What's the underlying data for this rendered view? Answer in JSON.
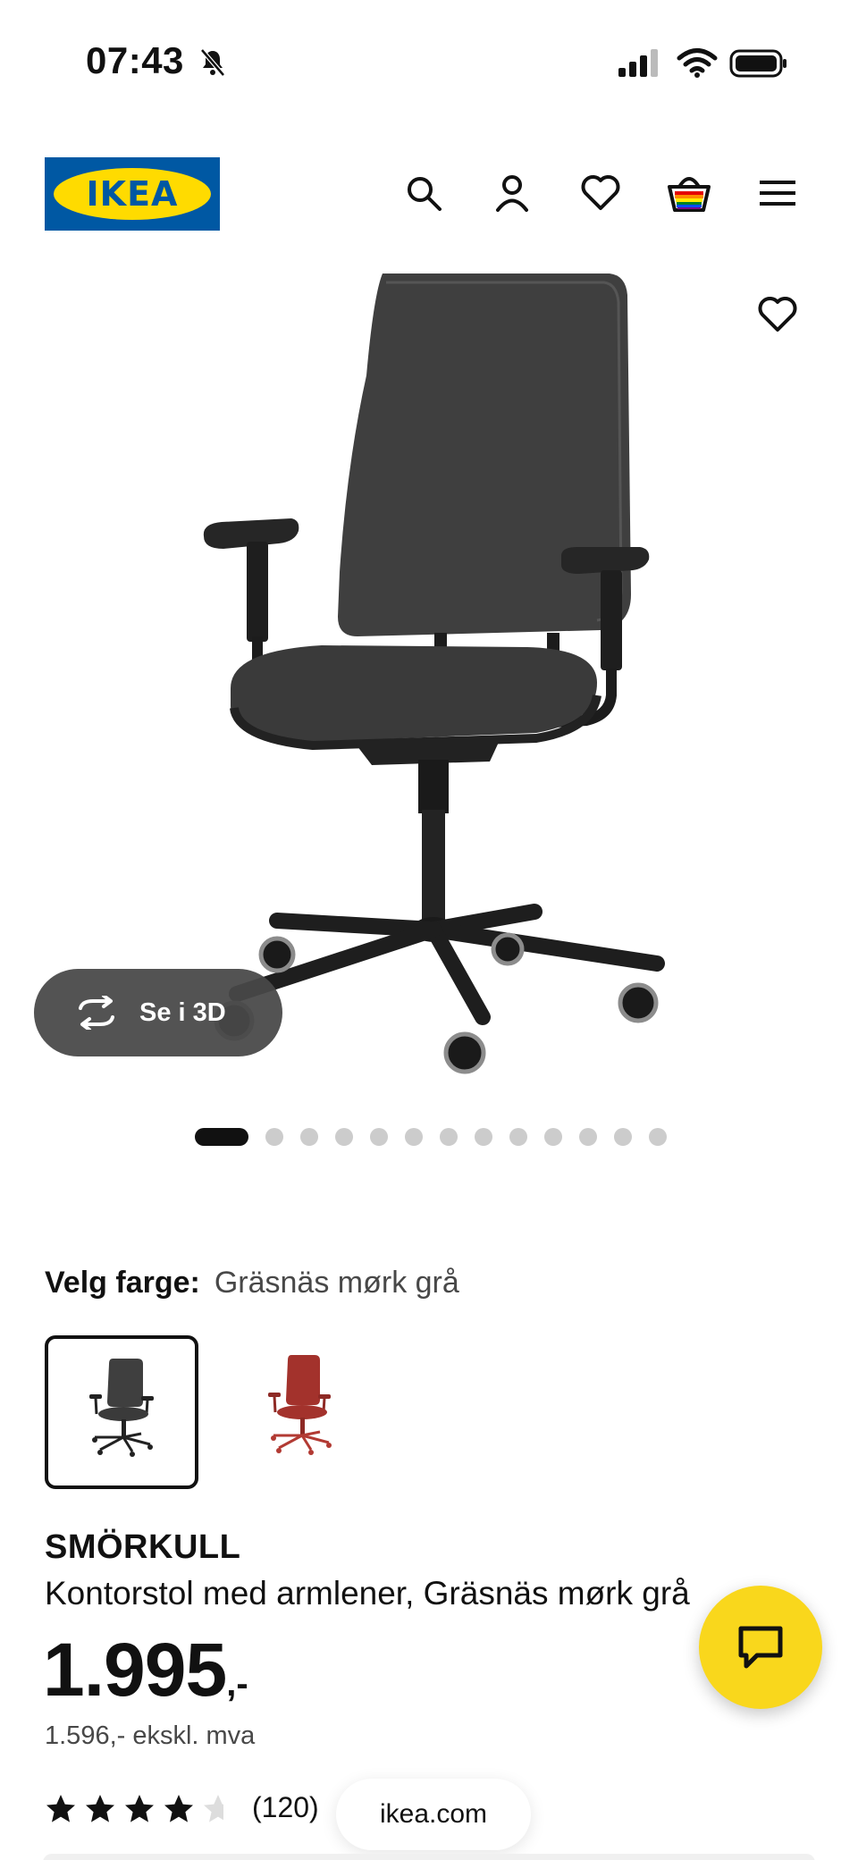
{
  "status_bar": {
    "time": "07:43",
    "icons": [
      "bell-slash-icon",
      "signal-icon",
      "wifi-icon",
      "battery-icon"
    ]
  },
  "header": {
    "logo_text": "IKEA",
    "icons": [
      "search-icon",
      "account-icon",
      "heart-icon",
      "basket-icon",
      "menu-icon"
    ]
  },
  "gallery": {
    "view_3d_label": "Se i 3D",
    "dot_count": 14,
    "active_index": 0
  },
  "colour": {
    "label": "Velg farge:",
    "selected_value": "Gräsnäs mørk grå",
    "swatches": [
      "dark-grey",
      "red"
    ]
  },
  "product": {
    "brand": "SMÖRKULL",
    "description": "Kontorstol med armlener, Gräsnäs mørk grå",
    "price_main": "1.995",
    "price_suffix": ",-",
    "price_ex_vat": "1.596,- ekskl. mva",
    "rating_value": 4.5,
    "rating_max": 5,
    "review_count": "(120)"
  },
  "browser": {
    "url": "ikea.com"
  },
  "colors": {
    "ikea_blue": "#0058a3",
    "ikea_yellow": "#ffdb00",
    "chat_yellow": "#f9d71c",
    "chair_dark": "#3a3a3a",
    "chair_red": "#a3322c"
  }
}
